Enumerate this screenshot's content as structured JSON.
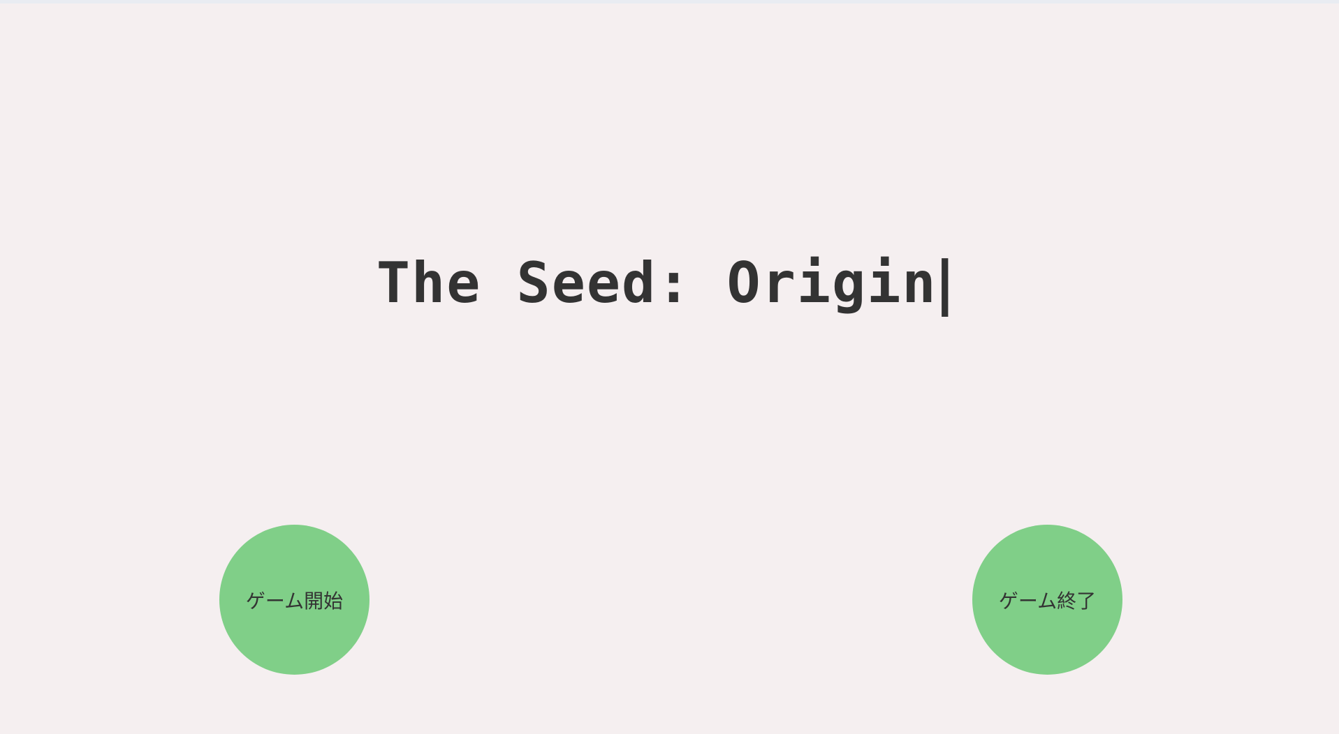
{
  "title": {
    "text": "The Seed: Origin",
    "caret": "|"
  },
  "buttons": {
    "start_label": "ゲーム開始",
    "quit_label": "ゲーム終了"
  },
  "colors": {
    "background": "#f5eff0",
    "button": "#80cf88",
    "text": "#333333"
  }
}
